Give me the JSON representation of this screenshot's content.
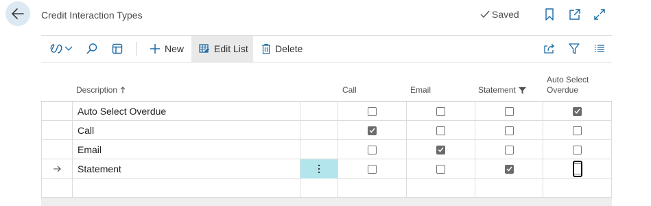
{
  "page": {
    "title": "Credit Interaction Types",
    "saved_label": "Saved"
  },
  "toolbar": {
    "new_label": "New",
    "edit_list_label": "Edit List",
    "delete_label": "Delete"
  },
  "columns": {
    "description": "Description",
    "call": "Call",
    "email": "Email",
    "statement": "Statement",
    "auto_select_line1": "Auto Select",
    "auto_select_line2": "Overdue"
  },
  "rows": [
    {
      "description": "Auto Select Overdue",
      "call": false,
      "email": false,
      "statement": false,
      "auto_select_overdue": true,
      "current": false
    },
    {
      "description": "Call",
      "call": true,
      "email": false,
      "statement": false,
      "auto_select_overdue": false,
      "current": false
    },
    {
      "description": "Email",
      "call": false,
      "email": true,
      "statement": false,
      "auto_select_overdue": false,
      "current": false
    },
    {
      "description": "Statement",
      "call": false,
      "email": false,
      "statement": true,
      "auto_select_overdue": false,
      "current": true
    }
  ],
  "colors": {
    "accent": "#1b6aa5",
    "selected_cell": "#b3e6ec",
    "back_button_bg": "#dde9f2"
  },
  "icons": [
    "arrow-left-icon",
    "checkmark-icon",
    "bookmark-icon",
    "open-new-window-icon",
    "expand-icon",
    "copilot-icon",
    "chevron-down-icon",
    "search-icon",
    "layout-icon",
    "plus-icon",
    "edit-list-icon",
    "trash-icon",
    "share-icon",
    "filter-icon",
    "list-icon",
    "sort-ascending-icon",
    "column-filter-icon",
    "row-arrow-icon",
    "more-options-icon"
  ]
}
